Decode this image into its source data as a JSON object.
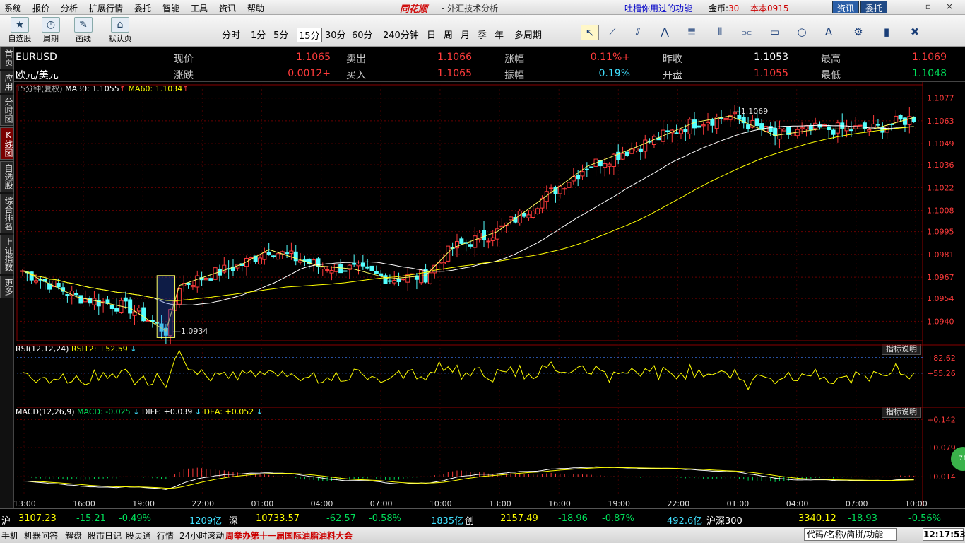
{
  "menu": [
    "系统",
    "报价",
    "分析",
    "扩展行情",
    "委托",
    "智能",
    "工具",
    "资讯",
    "帮助"
  ],
  "brand": "同花顺",
  "subtitle": "- 外汇技术分析",
  "promo": "吐槽你用过的功能",
  "gold_label": "金币:",
  "gold_value": "30",
  "account": "本本0915",
  "info_btn": "资讯",
  "trade_btn": "委托",
  "window_buttons": [
    "_",
    "▫",
    "×"
  ],
  "toolbar_buttons": [
    {
      "label": "自选股",
      "icon": "★"
    },
    {
      "label": "周期",
      "icon": "◷"
    },
    {
      "label": "画线",
      "icon": "✎"
    },
    {
      "label": "默认页",
      "icon": "⌂"
    }
  ],
  "periods": [
    "分时",
    "1分",
    "5分",
    "15分",
    "30分",
    "60分",
    "240分钟",
    "日",
    "周",
    "月",
    "季",
    "年",
    "多周期"
  ],
  "active_period": "15分",
  "drawing_tools": [
    "↖",
    "⟋",
    "⫽",
    "⋀",
    "≣",
    "⦀",
    "⫘",
    "▭",
    "○",
    "A",
    "⚙",
    "▮",
    "✖"
  ],
  "sidenav": [
    "首页",
    "应用",
    "分时图",
    "K线图",
    "自选股",
    "综合排名",
    "上证指数",
    "更多"
  ],
  "active_nav": "K线图",
  "quote": {
    "code": "EURUSD",
    "name": "欧元/美元",
    "items": [
      {
        "label": "现价",
        "value": "1.1065",
        "vcolor": "red"
      },
      {
        "label": "卖出",
        "value": "1.1066",
        "vcolor": "red"
      },
      {
        "label": "涨幅",
        "value": "+0.11%",
        "vcolor": "red"
      },
      {
        "label": "昨收",
        "value": "1.1053",
        "vcolor": "wht"
      },
      {
        "label": "最高",
        "value": "1.1069",
        "vcolor": "red"
      },
      {
        "label": "涨跌",
        "value": "+0.0012",
        "vcolor": "red"
      },
      {
        "label": "买入",
        "value": "1.1065",
        "vcolor": "red"
      },
      {
        "label": "振幅",
        "value": "0.19%",
        "vcolor": "cyn"
      },
      {
        "label": "开盘",
        "value": "1.1055",
        "vcolor": "red"
      },
      {
        "label": "最低",
        "value": "1.1048",
        "vcolor": "grn"
      }
    ]
  },
  "ma_legend": {
    "period": "15分钟(复权)",
    "ma30": "MA30: 1.1055",
    "ma30_arrow": "↑",
    "ma60": "MA60: 1.1034",
    "ma60_arrow": "↑"
  },
  "rsi_legend": {
    "title": "RSI(12,12,24)",
    "value": "RSI12: +52.59",
    "arrow": "↓"
  },
  "macd_legend": {
    "title": "MACD(12,26,9)",
    "macd": "MACD: -0.025",
    "macd_arrow": "↓",
    "diff": "DIFF: +0.039",
    "diff_arrow": "↓",
    "dea": "DEA: +0.052",
    "dea_arrow": "↓"
  },
  "indicator_explain": "指标说明",
  "chart_data": {
    "type": "candlestick",
    "symbol": "EURUSD",
    "price_ticks": [
      "1.1077",
      "1.1063",
      "1.1049",
      "1.1036",
      "1.1022",
      "1.1008",
      "1.0995",
      "1.0981",
      "1.0967",
      "1.0954",
      "1.0940"
    ],
    "price_range": [
      1.0928,
      1.1079
    ],
    "time_ticks": [
      "13:00",
      "16:00",
      "19:00",
      "22:00",
      "01:00",
      "04:00",
      "07:00",
      "10:00",
      "13:00",
      "16:00",
      "19:00",
      "22:00",
      "01:00",
      "04:00",
      "07:00",
      "10:00"
    ],
    "annotations": {
      "high": "1.1069",
      "low": "1.0934"
    },
    "anchors": [
      [
        0,
        1.0971
      ],
      [
        12,
        1.0955
      ],
      [
        24,
        1.0948
      ],
      [
        32,
        1.0934
      ],
      [
        35,
        1.0962
      ],
      [
        49,
        1.0975
      ],
      [
        55,
        1.0984
      ],
      [
        66,
        1.0974
      ],
      [
        74,
        1.0972
      ],
      [
        82,
        1.0966
      ],
      [
        90,
        1.0968
      ],
      [
        96,
        1.0985
      ],
      [
        106,
        1.0995
      ],
      [
        116,
        1.1015
      ],
      [
        126,
        1.1035
      ],
      [
        138,
        1.1048
      ],
      [
        150,
        1.1062
      ],
      [
        158,
        1.1066
      ],
      [
        168,
        1.1054
      ],
      [
        178,
        1.1058
      ],
      [
        190,
        1.1058
      ],
      [
        199,
        1.1065
      ]
    ],
    "rsi": {
      "ticks": [
        "82.62",
        "55.26"
      ],
      "range": [
        0,
        100
      ]
    },
    "macd": {
      "ticks": [
        "0.142",
        "0.079",
        "0.014"
      ],
      "range": [
        -0.03,
        0.16
      ]
    }
  },
  "index_bar": [
    {
      "t": "沪",
      "c": "wht"
    },
    {
      "t": "3107.23",
      "c": "yel"
    },
    {
      "t": "-15.21",
      "c": "grn"
    },
    {
      "t": "-0.49%",
      "c": "grn"
    },
    {
      "t": "1209亿",
      "c": "cyn"
    },
    {
      "t": "深",
      "c": "wht"
    },
    {
      "t": "10733.57",
      "c": "yel"
    },
    {
      "t": "-62.57",
      "c": "grn"
    },
    {
      "t": "-0.58%",
      "c": "grn"
    },
    {
      "t": "1835亿",
      "c": "cyn"
    },
    {
      "t": "创",
      "c": "wht"
    },
    {
      "t": "2157.49",
      "c": "yel"
    },
    {
      "t": "-18.96",
      "c": "grn"
    },
    {
      "t": "-0.87%",
      "c": "grn"
    },
    {
      "t": "492.6亿",
      "c": "cyn"
    },
    {
      "t": "沪深300",
      "c": "wht"
    },
    {
      "t": "3340.12",
      "c": "yel"
    },
    {
      "t": "-18.93",
      "c": "grn"
    },
    {
      "t": "-0.56%",
      "c": "grn"
    }
  ],
  "bottom_tabs": [
    "手机",
    "机器问答",
    "解盘",
    "股市日记",
    "股灵通",
    "行情",
    "24小时滚动"
  ],
  "scroll_text": "周举办第十一届国际油脂油料大会",
  "search_placeholder": "代码/名称/简拼/功能",
  "clock": "12:17:53",
  "badge": "71"
}
